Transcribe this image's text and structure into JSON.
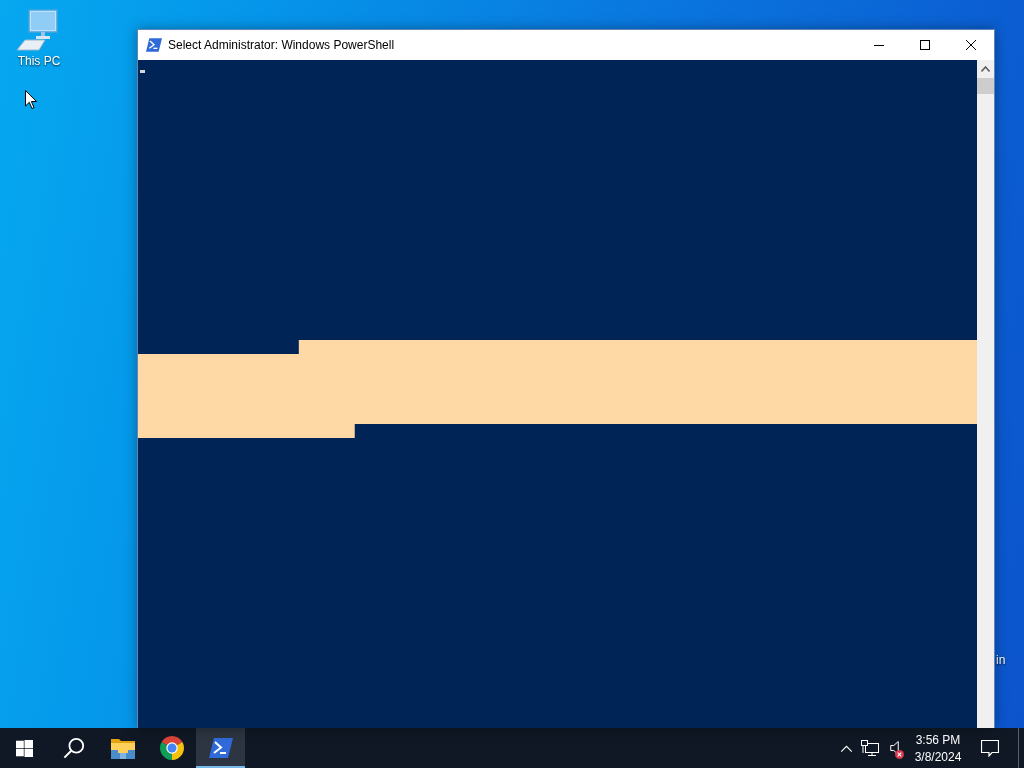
{
  "desktop": {
    "icons": [
      {
        "label": "This PC"
      }
    ],
    "background_text": "in"
  },
  "window": {
    "title": "Select Administrator: Windows PowerShell",
    "text_selected": true
  },
  "taskbar": {
    "apps": [
      {
        "kind": "start",
        "selected": false
      },
      {
        "kind": "search",
        "selected": false
      },
      {
        "kind": "explorer",
        "selected": false
      },
      {
        "kind": "chrome",
        "selected": false
      },
      {
        "kind": "powershell",
        "selected": true
      }
    ],
    "tray": {
      "volume_muted": true,
      "time": "3:56 PM",
      "date": "3/8/2024"
    }
  }
}
